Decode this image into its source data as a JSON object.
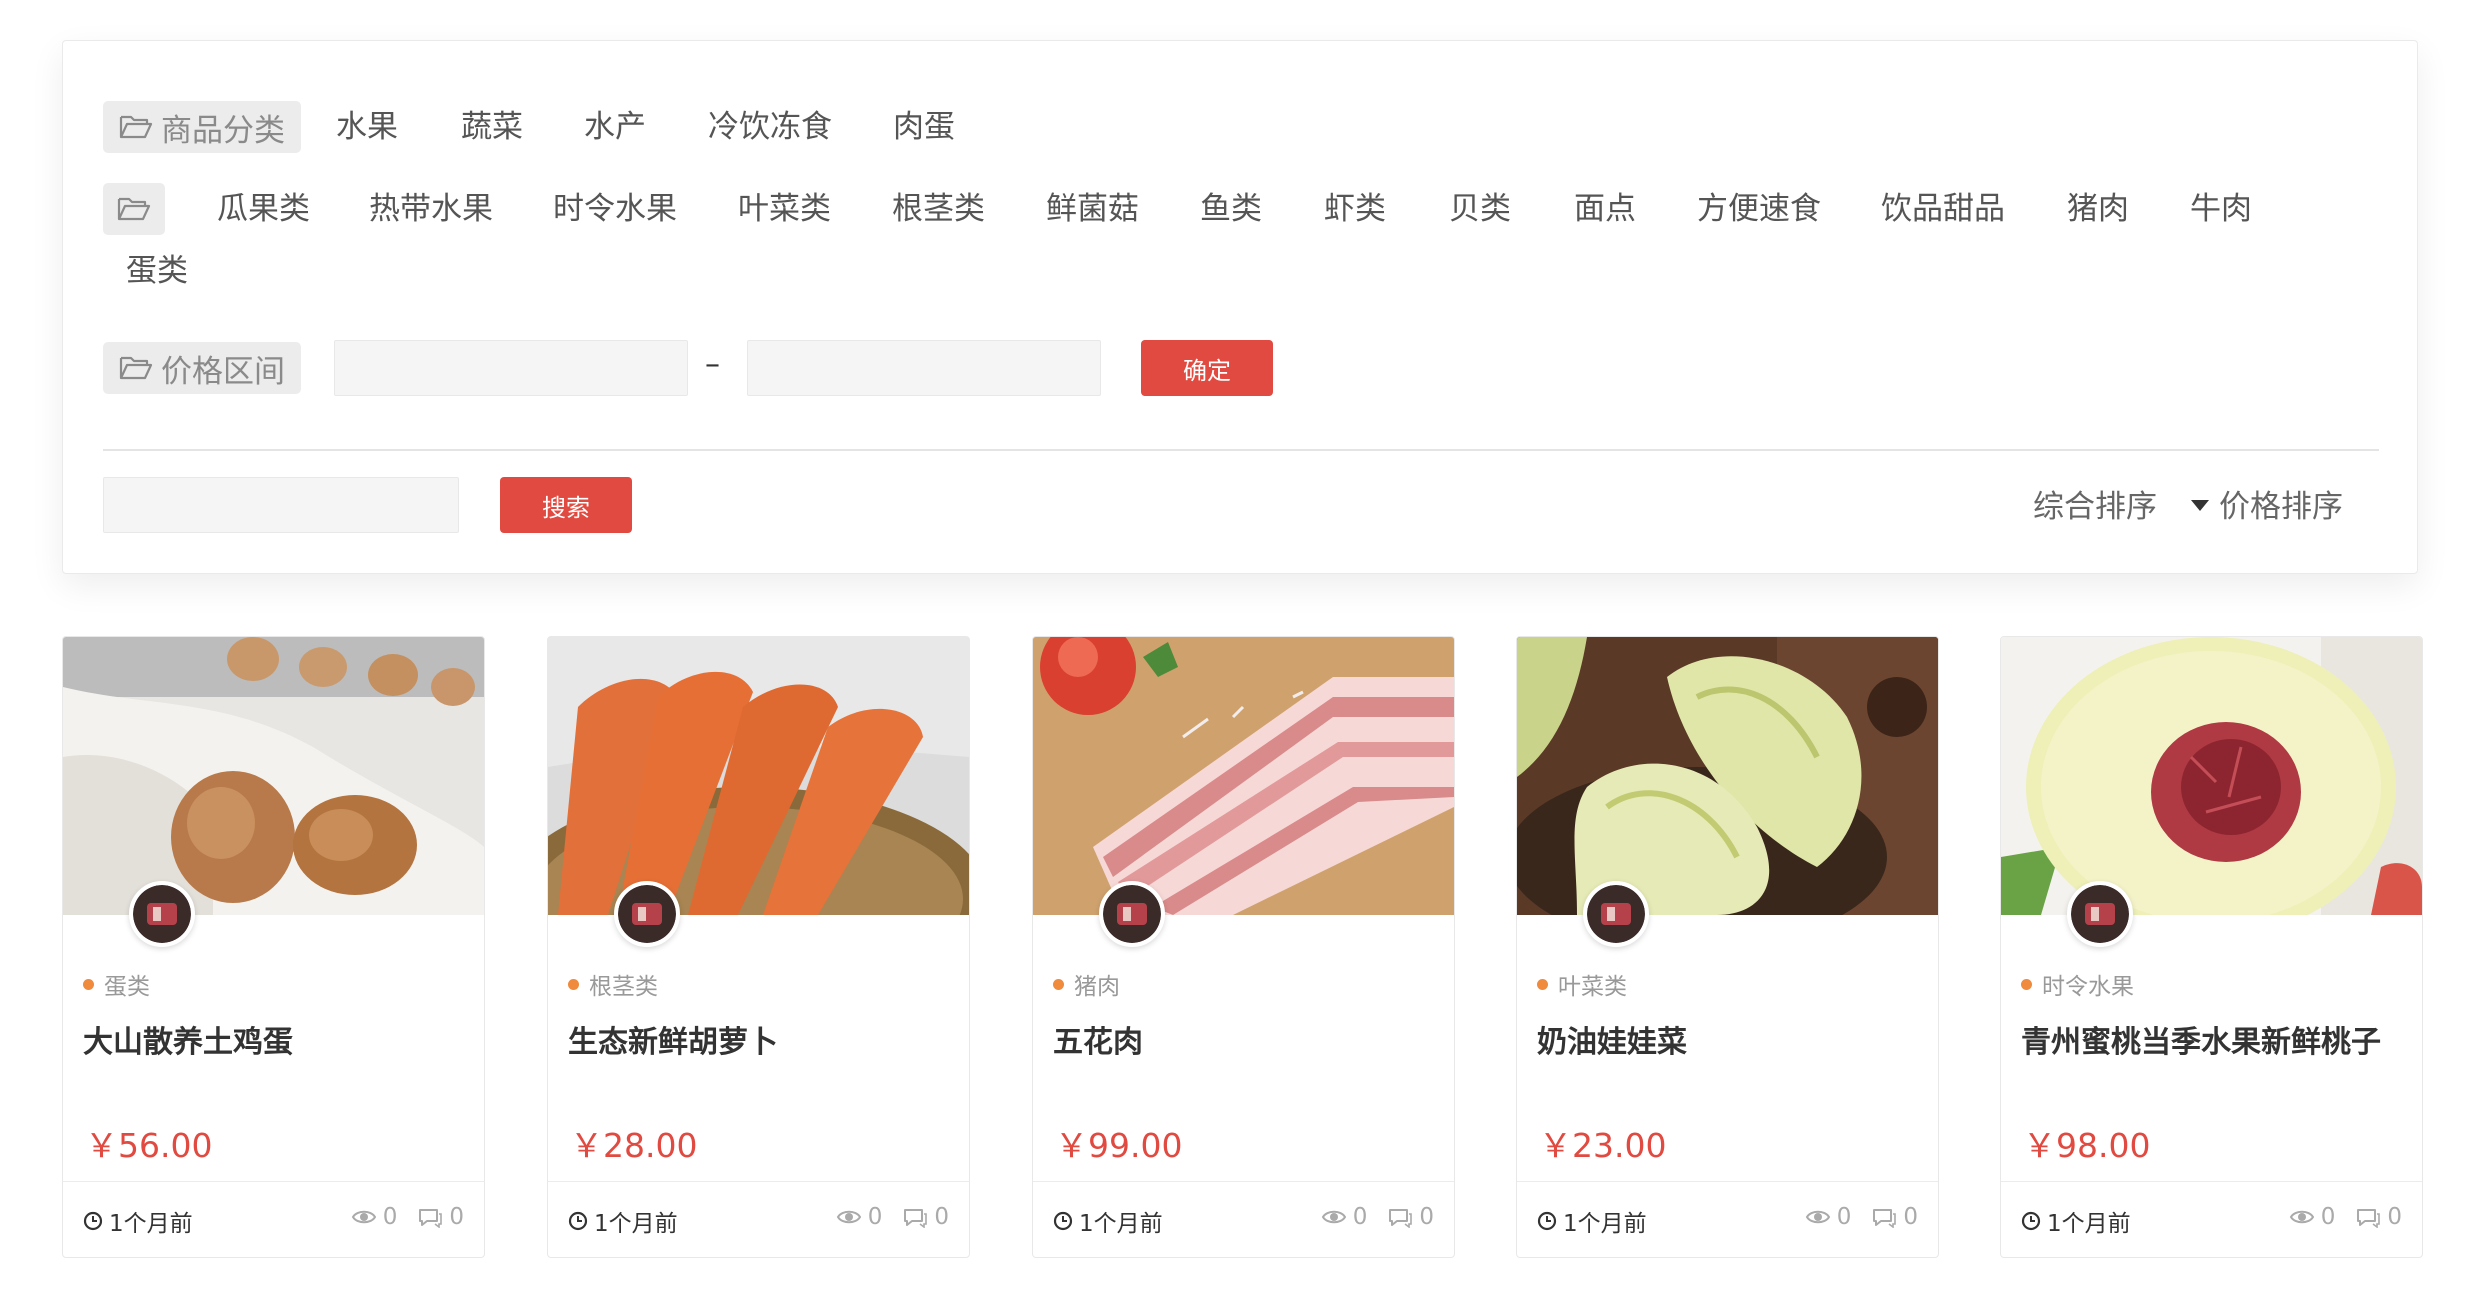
{
  "filters": {
    "category_label": "商品分类",
    "categories": [
      "水果",
      "蔬菜",
      "水产",
      "冷饮冻食",
      "肉蛋"
    ],
    "subcategories": [
      "瓜果类",
      "热带水果",
      "时令水果",
      "叶菜类",
      "根茎类",
      "鲜菌菇",
      "鱼类",
      "虾类",
      "贝类",
      "面点",
      "方便速食",
      "饮品甜品",
      "猪肉",
      "牛肉",
      "蛋类"
    ],
    "price_label": "价格区间",
    "price_min_value": "",
    "price_max_value": "",
    "price_dash": "–",
    "confirm_label": "确定",
    "search_value": "",
    "search_label": "搜索",
    "sort_overall": "综合排序",
    "sort_price": "价格排序"
  },
  "products": [
    {
      "category": "蛋类",
      "title": "大山散养土鸡蛋",
      "price": "￥56.00",
      "time": "1个月前",
      "views": "0",
      "comments": "0"
    },
    {
      "category": "根茎类",
      "title": "生态新鲜胡萝卜",
      "price": "￥28.00",
      "time": "1个月前",
      "views": "0",
      "comments": "0"
    },
    {
      "category": "猪肉",
      "title": "五花肉",
      "price": "￥99.00",
      "time": "1个月前",
      "views": "0",
      "comments": "0"
    },
    {
      "category": "叶菜类",
      "title": "奶油娃娃菜",
      "price": "￥23.00",
      "time": "1个月前",
      "views": "0",
      "comments": "0"
    },
    {
      "category": "时令水果",
      "title": "青州蜜桃当季水果新鲜桃子",
      "price": "￥98.00",
      "time": "1个月前",
      "views": "0",
      "comments": "0"
    }
  ],
  "icons": {
    "folder": "folder-open-icon",
    "clock": "clock-icon",
    "eye": "eye-icon",
    "comment": "comment-icon",
    "caret": "caret-down-icon"
  },
  "colors": {
    "accent": "#e14a40",
    "category_dot": "#f08a3c",
    "tag_bg": "#ececec"
  }
}
